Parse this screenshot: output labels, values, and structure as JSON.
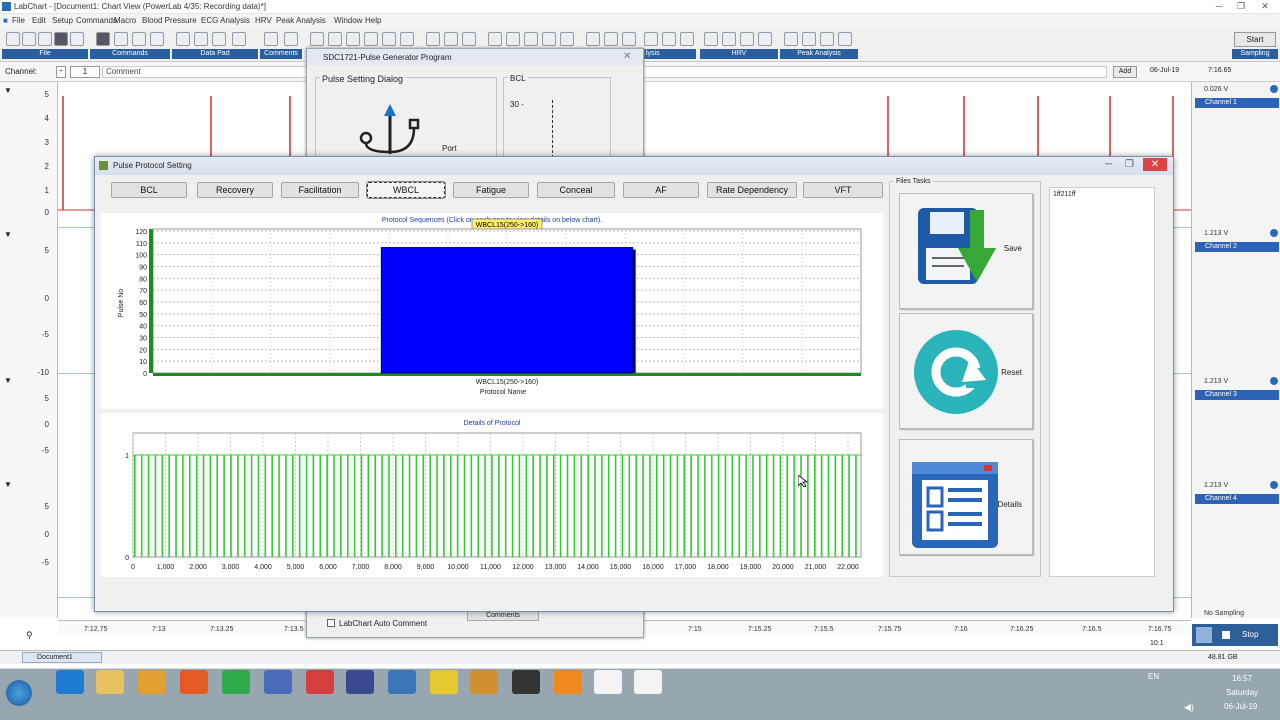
{
  "window": {
    "title": "LabChart - [Document1: Chart View (PowerLab 4/35: Recording data)*]"
  },
  "menu": [
    "File",
    "Edit",
    "Setup",
    "Commands",
    "Macro",
    "Blood Pressure",
    "ECG Analysis",
    "HRV",
    "Peak Analysis",
    "Window",
    "Help"
  ],
  "toolbar_groups": [
    "File",
    "Commands",
    "Data Pad",
    "Comments",
    "HRV",
    "Peak Analysis",
    "Sampling"
  ],
  "toolbar_partial_label": "lysis",
  "start_label": "Start",
  "channel_bar": {
    "label": "Channel:",
    "channel_value": "1",
    "comment_placeholder": "Comment",
    "add_label": "Add",
    "date": "06-Jul-19",
    "time": "7:16.65"
  },
  "left_axis": {
    "ch1": [
      "5",
      "4",
      "3",
      "2",
      "1",
      "0"
    ],
    "ch2": [
      "5",
      "0",
      "-5",
      "-10"
    ],
    "ch3": [
      "5",
      "0",
      "-5"
    ],
    "ch4": [
      "5",
      "0",
      "-5"
    ]
  },
  "channels": [
    {
      "value": "0.026 V",
      "name": "Channel 1",
      "color": "#cc2020"
    },
    {
      "value": "1.213 V",
      "name": "Channel 2",
      "color": "#2060cc"
    },
    {
      "value": "1.213 V",
      "name": "Channel 3",
      "color": "#208040"
    },
    {
      "value": "1.213 V",
      "name": "Channel 4",
      "color": "#c020c0"
    }
  ],
  "sampling": {
    "no_sampling": "No Sampling",
    "stop_label": "Stop",
    "zoom": "10:1",
    "disk": "48.81 GB"
  },
  "time_axis": [
    "7:12.75",
    "7:13",
    "7:13.25",
    "7:13.5",
    "7:15",
    "7:15.25",
    "7:15.5",
    "7:15.75",
    "7:16",
    "7:16.25",
    "7:16.5",
    "7:16.75"
  ],
  "sdc": {
    "title": "SDC1721-Pulse Generator Program",
    "group": "Pulse Setting Dialog",
    "port": "Port",
    "bcl": "BCL",
    "bcl_value": "30 -",
    "auto_comment": "LabChart Auto Comment",
    "comments_btn": "Comments"
  },
  "dialog": {
    "title": "Pulse Protocol Setting",
    "tabs": [
      "BCL",
      "Recovery",
      "Facilitation",
      "WBCL",
      "Fatigue",
      "Conceal",
      "AF",
      "Rate Dependency",
      "VFT"
    ],
    "active_tab": "WBCL",
    "files_tasks": "Files Tasks",
    "save": "Save",
    "reset": "Reset",
    "details": "Details",
    "list_item": "1ff211ff"
  },
  "chart_data": [
    {
      "type": "bar",
      "title": "Protocol Sequences (Click on each one to view details on below chart).",
      "xlabel": "Protocol Name",
      "ylabel": "Pulse No",
      "categories": [
        "WBCL15(250->160)"
      ],
      "values": [
        106
      ],
      "ylim": [
        0,
        120
      ],
      "yticks": [
        0,
        10,
        20,
        30,
        40,
        50,
        60,
        70,
        80,
        90,
        100,
        110,
        120
      ],
      "tooltip": "WBCL15(250->160)",
      "color": "#0000ff",
      "grid": true
    },
    {
      "type": "bar",
      "title": "Details of Protocol",
      "xlabel": "",
      "ylabel": "",
      "ylim": [
        0,
        1
      ],
      "xlim": [
        0,
        22400
      ],
      "yticks": [
        0,
        1
      ],
      "xticks": [
        "0",
        "1,000",
        "2,000",
        "3,000",
        "4,000",
        "5,000",
        "6,000",
        "7,000",
        "8,000",
        "9,000",
        "10,000",
        "11,000",
        "12,000",
        "13,000",
        "14,000",
        "15,000",
        "16,000",
        "17,000",
        "18,000",
        "19,000",
        "20,000",
        "21,000",
        "22,000"
      ],
      "pulse_count": 106,
      "pulse_value": 1,
      "color": "#33cc33",
      "grid": true
    }
  ],
  "taskbar": {
    "lang": "EN",
    "time": "16:57",
    "day": "Saturday",
    "date": "06-Jul-19",
    "doc_tab": "Document1"
  }
}
